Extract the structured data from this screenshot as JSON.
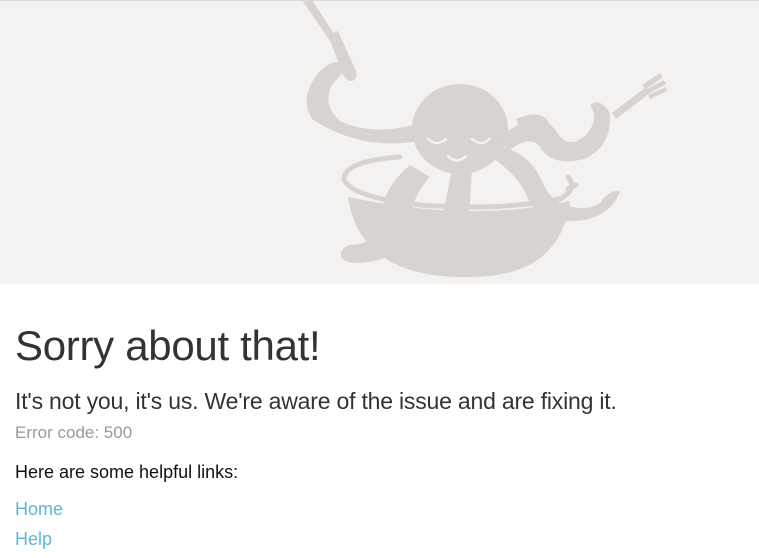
{
  "hero": {
    "illustration": "octopus-with-knife-and-fork-icon",
    "background": "#f3f2f1",
    "illustration_color": "#d7d3cf"
  },
  "error": {
    "title": "Sorry about that!",
    "message": "It's not you, it's us. We're aware of the issue and are fixing it.",
    "code_text": "Error code: 500"
  },
  "links": {
    "heading": "Here are some helpful links:",
    "items": [
      {
        "label": "Home"
      },
      {
        "label": "Help"
      }
    ],
    "link_color": "#5fb6d5"
  }
}
